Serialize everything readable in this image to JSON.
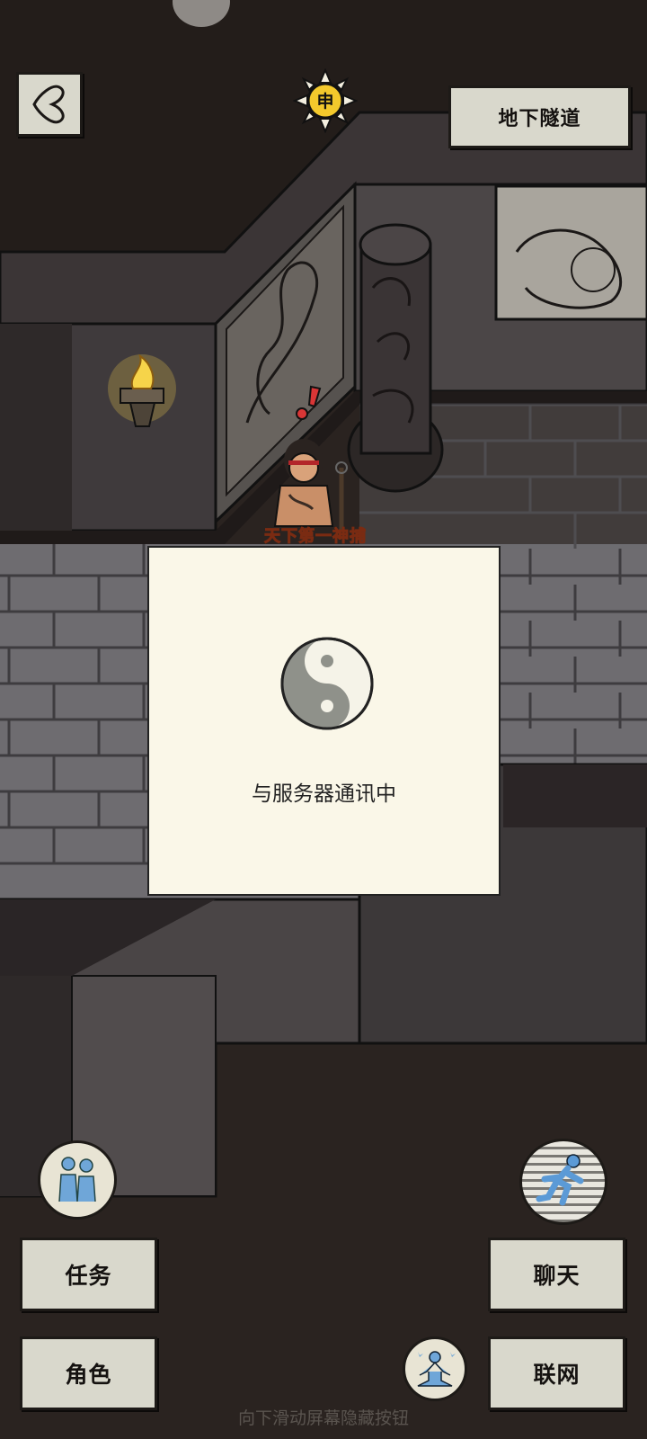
{
  "location": {
    "name": "地下隧道"
  },
  "time_badge": {
    "label": "申"
  },
  "character": {
    "title": "天下第一神捕"
  },
  "dialog": {
    "message": "与服务器通讯中"
  },
  "buttons": {
    "task": "任务",
    "role": "角色",
    "chat": "聊天",
    "network": "联网"
  },
  "hint": "向下滑动屏幕隐藏按钮",
  "colors": {
    "panel": "#d9d8cc",
    "dialog_bg": "#faf7e8",
    "wall_brick": "#6e6c70",
    "floor_dark": "#2a2320",
    "torch_flame": "#f6d44a",
    "icon_blue": "#6fa6d8"
  }
}
